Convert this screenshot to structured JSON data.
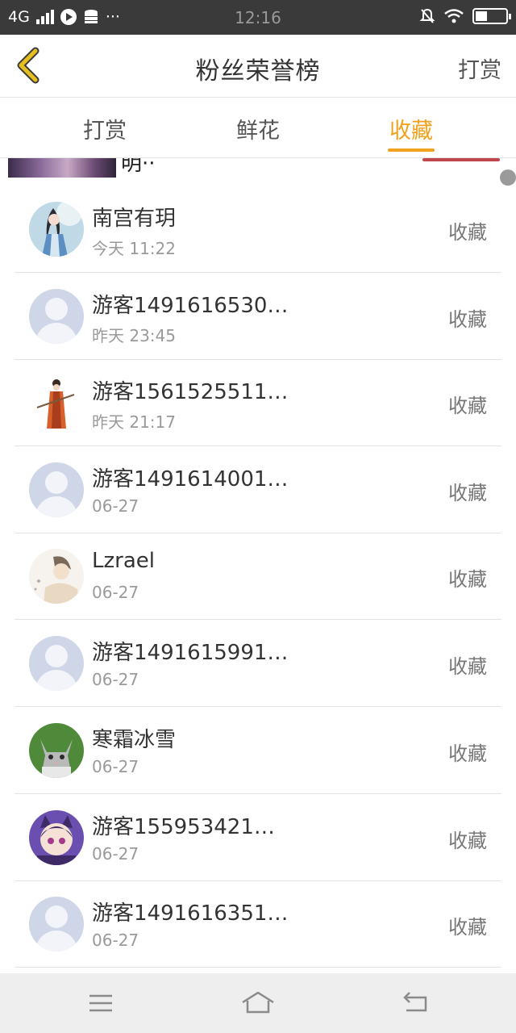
{
  "status_bar": {
    "network": "4G",
    "time": "12:16",
    "more": "···"
  },
  "header": {
    "title": "粉丝荣誉榜",
    "action": "打赏"
  },
  "tabs": [
    {
      "label": "打赏",
      "active": false
    },
    {
      "label": "鲜花",
      "active": false
    },
    {
      "label": "收藏",
      "active": true
    }
  ],
  "partial_row": {
    "text": "明··"
  },
  "rows": [
    {
      "name": "南宫有玥",
      "time": "今天 11:22",
      "tag": "收藏",
      "avatar": "anime-girl-blue"
    },
    {
      "name": "游客1491616530…",
      "time": "昨天 23:45",
      "tag": "收藏",
      "avatar": "default"
    },
    {
      "name": "游客1561525511…",
      "time": "昨天 21:17",
      "tag": "收藏",
      "avatar": "warrior-figure"
    },
    {
      "name": "游客1491614001…",
      "time": "06-27",
      "tag": "收藏",
      "avatar": "default"
    },
    {
      "name": "Lzrael",
      "time": "06-27",
      "tag": "收藏",
      "avatar": "anime-boy-sketch"
    },
    {
      "name": "游客1491615991…",
      "time": "06-27",
      "tag": "收藏",
      "avatar": "default"
    },
    {
      "name": "寒霜冰雪",
      "time": "06-27",
      "tag": "收藏",
      "avatar": "kitten"
    },
    {
      "name": "游客155953421…",
      "time": "06-27",
      "tag": "收藏",
      "avatar": "anime-cat-girl"
    },
    {
      "name": "游客1491616351…",
      "time": "06-27",
      "tag": "收藏",
      "avatar": "default"
    }
  ],
  "colors": {
    "accent": "#f0a21e",
    "back_arrow": "#e6c020",
    "divider": "#e3e3e3"
  }
}
